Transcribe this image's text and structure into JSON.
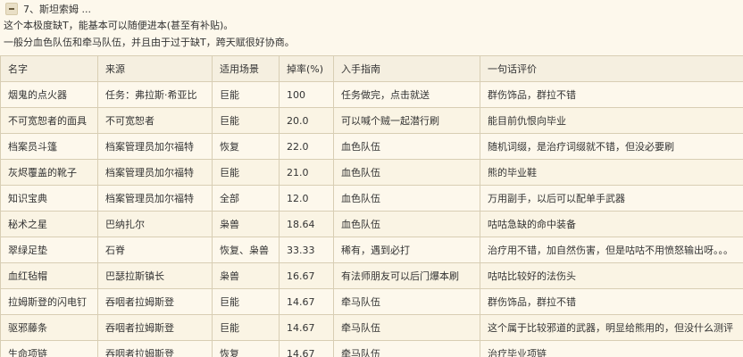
{
  "section": {
    "title": "7、斯坦索姆 ..."
  },
  "intro": [
    "这个本极度缺T，能基本可以随便进本(甚至有补贴)。",
    "一般分血色队伍和牵马队伍，并且由于过于缺T，跨天赋很好协商。"
  ],
  "table": {
    "headers": [
      "名字",
      "来源",
      "适用场景",
      "掉率(%)",
      "入手指南",
      "一句话评价"
    ],
    "rows": [
      [
        "烟鬼的点火器",
        "任务：弗拉斯·希亚比",
        "巨能",
        "100",
        "任务做完，点击就送",
        "群伤饰品，群拉不错"
      ],
      [
        "不可宽恕者的面具",
        "不可宽恕者",
        "巨能",
        "20.0",
        "可以喊个贼一起潜行刷",
        "能目前仇恨向毕业"
      ],
      [
        "档案员斗篷",
        "档案管理员加尔福特",
        "恢复",
        "22.0",
        "血色队伍",
        "随机词缀，是治疗词缀就不错，但没必要刷"
      ],
      [
        "灰烬覆盖的靴子",
        "档案管理员加尔福特",
        "巨能",
        "21.0",
        "血色队伍",
        "熊的毕业鞋"
      ],
      [
        "知识宝典",
        "档案管理员加尔福特",
        "全部",
        "12.0",
        "血色队伍",
        "万用副手，以后可以配单手武器"
      ],
      [
        "秘术之星",
        "巴纳扎尔",
        "枭兽",
        "18.64",
        "血色队伍",
        "咕咕急缺的命中装备"
      ],
      [
        "翠绿足垫",
        "石脊",
        "恢复、枭兽",
        "33.33",
        "稀有，遇到必打",
        "治疗用不错，加自然伤害，但是咕咕不用愤怒输出呀。。。"
      ],
      [
        "血红毡帽",
        "巴瑟拉斯镇长",
        "枭兽",
        "16.67",
        "有法师朋友可以后门爆本刷",
        "咕咕比较好的法伤头"
      ],
      [
        "拉姆斯登的闪电钉",
        "吞咽者拉姆斯登",
        "巨能",
        "14.67",
        "牵马队伍",
        "群伤饰品，群拉不错"
      ],
      [
        "驱邪藤条",
        "吞咽者拉姆斯登",
        "巨能",
        "14.67",
        "牵马队伍",
        "这个属于比较邪道的武器，明显给熊用的，但没什么测评"
      ],
      [
        "生命项链",
        "吞咽者拉姆斯登",
        "恢复",
        "14.67",
        "牵马队伍",
        "治疗毕业项链"
      ]
    ]
  }
}
